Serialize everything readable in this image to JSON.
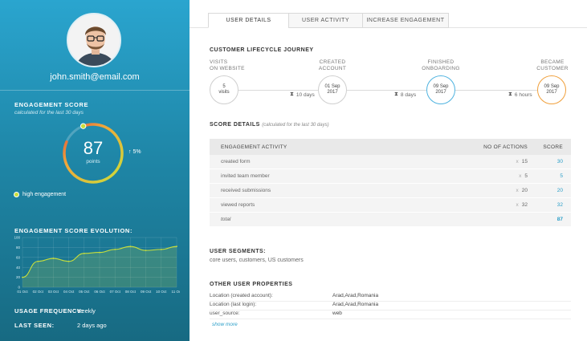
{
  "user": {
    "email": "john.smith@email.com"
  },
  "engagement": {
    "title": "ENGAGEMENT SCORE",
    "subtitle": "calculated for the last 30 days",
    "score": "87",
    "unit": "points",
    "trend": "5%",
    "level_label": "high engagement",
    "level_color": "#c9df3b",
    "score_fraction": 0.87
  },
  "evolution": {
    "title": "ENGAGEMENT SCORE EVOLUTION:"
  },
  "usage": {
    "label": "USAGE FREQUENCY:",
    "value": "weekly"
  },
  "last_seen": {
    "label": "LAST SEEN:",
    "value": "2 days ago"
  },
  "tabs": [
    {
      "label": "USER DETAILS"
    },
    {
      "label": "USER ACTIVITY"
    },
    {
      "label": "INCREASE ENGAGEMENT"
    }
  ],
  "journey": {
    "title": "CUSTOMER LIFECYCLE JOURNEY",
    "stages": [
      {
        "label": "VISITS\nON WEBSITE",
        "line1": "5",
        "line2": "visits"
      },
      {
        "label": "CREATED\nACCOUNT",
        "line1": "01 Sep",
        "line2": "2017"
      },
      {
        "label": "FINISHED\nONBOARDING",
        "line1": "09 Sep",
        "line2": "2017"
      },
      {
        "label": "BECAME\nCUSTOMER",
        "line1": "09 Sep",
        "line2": "2017"
      }
    ],
    "gaps": [
      "10 days",
      "8 days",
      "6 hours"
    ]
  },
  "score_details": {
    "title": "SCORE DETAILS",
    "note": "(calculated for the last 30 days)",
    "headers": [
      "ENGAGEMENT ACTIVITY",
      "NO OF ACTIONS",
      "SCORE"
    ],
    "rows": [
      {
        "activity": "created form",
        "mult": "x",
        "actions": "15",
        "score": "30"
      },
      {
        "activity": "invited team member",
        "mult": "x",
        "actions": "5",
        "score": "5"
      },
      {
        "activity": "received submissions",
        "mult": "x",
        "actions": "20",
        "score": "20"
      },
      {
        "activity": "viewed reports",
        "mult": "x",
        "actions": "32",
        "score": "32"
      }
    ],
    "total_label": "total",
    "total_score": "87"
  },
  "segments": {
    "title": "USER SEGMENTS:",
    "value": "core users, customers, US customers"
  },
  "properties": {
    "title": "OTHER USER PROPERTIES",
    "rows": [
      {
        "key": "Location (created account):",
        "value": "Arad,Arad,Romania"
      },
      {
        "key": "Location (last login):",
        "value": "Arad,Arad,Romania"
      },
      {
        "key": "user_source:",
        "value": "web"
      }
    ],
    "show_more": "show more"
  },
  "colors": {
    "accent": "#2a9ec8",
    "stage_created": "#cfcfcf",
    "stage_onboarding": "#4fb3e0",
    "stage_customer": "#f0a03c"
  },
  "chart_data": {
    "type": "area",
    "title": "",
    "xlabel": "",
    "ylabel": "",
    "ylim": [
      0,
      100
    ],
    "yticks": [
      "0",
      "20",
      "40",
      "60",
      "80",
      "100"
    ],
    "categories": [
      "01 Oct",
      "02 Oct",
      "03 Oct",
      "04 Oct",
      "05 Oct",
      "06 Oct",
      "07 Oct",
      "08 Oct",
      "09 Oct",
      "10 Oct",
      "11 Oct"
    ],
    "values": [
      20,
      52,
      58,
      52,
      68,
      70,
      76,
      82,
      74,
      76,
      82
    ],
    "grid": true
  }
}
